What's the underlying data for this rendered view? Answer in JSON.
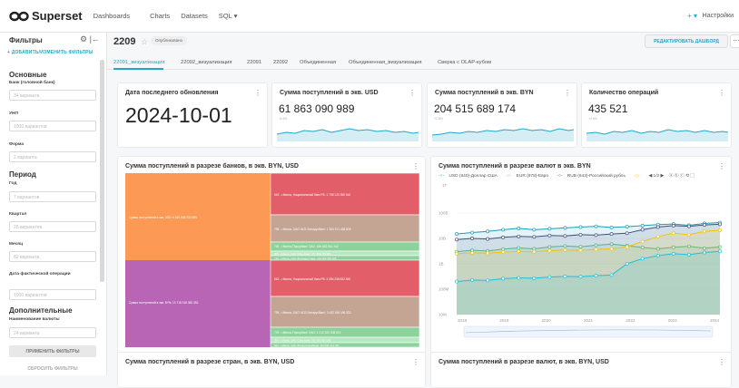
{
  "nav": {
    "logo": "Superset",
    "items": [
      "Dashboards",
      "Charts",
      "Datasets",
      "SQL ▾"
    ],
    "plus": "+ ▾",
    "settings": "Настройки"
  },
  "sidebar": {
    "title": "Фильтры",
    "add_link": "+ ДОБАВИТЬ/ИЗМЕНИТЬ ФИЛЬТРЫ",
    "sections": {
      "basic": "Основные",
      "period": "Период",
      "extra": "Дополнительные"
    },
    "filters": [
      {
        "label": "Банк (головной банк)",
        "placeholder": "34 варианта"
      },
      {
        "label": "УНП",
        "placeholder": "1000 вариантов"
      },
      {
        "label": "Форма",
        "placeholder": "2 варианта"
      },
      {
        "label": "Год",
        "placeholder": "7 вариантов"
      },
      {
        "label": "Квартал",
        "placeholder": "28 вариантов"
      },
      {
        "label": "Месяц",
        "placeholder": "82 варианта"
      },
      {
        "label": "Дата фактической операции",
        "placeholder": "1000 вариантов"
      },
      {
        "label": "Наименование валюты",
        "placeholder": "24 варианта"
      }
    ],
    "apply": "ПРИМЕНИТЬ ФИЛЬТРЫ",
    "clear": "СБРОСИТЬ ФИЛЬТРЫ"
  },
  "header": {
    "title": "2209",
    "badge": "Опубликовано",
    "edit": "РЕДАКТИРОВАТЬ ДАШБОРД",
    "more": "⋯"
  },
  "tabs": [
    "22091_визуализация",
    "22092_визуализация",
    "22091",
    "22092",
    "Объединенная",
    "Объединенная_визуализация",
    "Сверка с OLAP-кубом"
  ],
  "cards": {
    "last_update": {
      "title": "Дата последнего обновления",
      "value": "2024-10-01"
    },
    "kpis": [
      {
        "title": "Сумма поступлений в экв. USD",
        "value": "61 863 090 989",
        "delta": "-5.4%"
      },
      {
        "title": "Сумма поступлений в экв. BYN",
        "value": "204 515 689 174",
        "delta": "+2.8%"
      },
      {
        "title": "Количество операций",
        "value": "435 521",
        "delta": "+4.6%"
      }
    ],
    "treemap_title": "Сумма поступлений в разрезе банков, в экв. BYN, USD",
    "currency_title": "Сумма поступлений в разрезе валют в экв. BYN",
    "bottom_left_title": "Сумма поступлений в разрезе стран, в экв. BYN, USD",
    "bottom_right_title": "Сумма поступлений в разрезе валют, в экв. BYN, USD"
  },
  "treemap": {
    "usd_label": "Сумма поступлений в экв. USD: 6 549 838 332 889",
    "byn_label": "Сумма поступлений в экв. BYN: 13 718 318 382 352",
    "usd_banks": [
      "642 - г.Минск, Национальный банк РБ: 1 738 120 355 646",
      "795 - г.Минск, ОАО 'АСБ Беларусбанк': 1 354 071 408 838",
      "749 - г.Минск,'Приорбанк' ОАО: 406 832 951 442",
      "369 - г.Минск, ОАО 'Сбер Банк': 357 898 755 082",
      "739 - г.Минск, ОАО 'Белинвестбанк': 242 093 350 398"
    ],
    "byn_banks": [
      "642 - г.Минск, Национальный банк РБ: 4 054 238 832 846",
      "795 - г.Минск, ОАО 'АСБ Беларусбанк': 3 432 348 156 332",
      "749 - г.Минск,'Приорбанк' ОАО: 1 212 030 208 815",
      "369 - г.Минск, ОАО 'Сбер Банк': 893 903 952 083",
      "964 - г.Минск, ОАО 'Белагропромбанк': 900 997 312 021"
    ]
  },
  "chart_data": {
    "type": "line",
    "title": "Сумма поступлений в разрезе валют в экв. BYN",
    "legend_position": "top",
    "x_ticks": [
      "2018",
      "2019",
      "2020",
      "2021",
      "2022",
      "2023",
      "2024"
    ],
    "y_ticks": [
      "10M",
      "100M",
      "1B",
      "10B",
      "100B"
    ],
    "y_top_label": "1T",
    "y_scale": "log",
    "legend_pager": "◀ 1/2 ▶",
    "series": [
      {
        "name": "USD (840)-Доллар США",
        "color": "#1f9bbd",
        "values": [
          15000000000.0,
          17000000000.0,
          19000000000.0,
          22000000000.0,
          25000000000.0,
          22000000000.0,
          24000000000.0,
          26000000000.0,
          28000000000.0,
          30000000000.0,
          27000000000.0,
          29000000000.0,
          32000000000.0,
          35000000000.0,
          37000000000.0,
          33000000000.0,
          39000000000.0,
          42000000000.0
        ]
      },
      {
        "name": "EUR (978)-Евро",
        "color": "#5ac189",
        "values": [
          3000000000.0,
          3400000000.0,
          3200000000.0,
          3800000000.0,
          4200000000.0,
          3900000000.0,
          4600000000.0,
          5000000000.0,
          4700000000.0,
          5400000000.0,
          6000000000.0,
          5200000000.0,
          4400000000.0,
          3900000000.0,
          4500000000.0,
          4900000000.0,
          4100000000.0,
          4600000000.0
        ]
      },
      {
        "name": "RUB (643)-Российский рубль",
        "color": "#454e7c",
        "values": [
          9000000000.0,
          10000000000.0,
          9500000000.0,
          11000000000.0,
          12000000000.0,
          11500000000.0,
          13000000000.0,
          12500000000.0,
          14000000000.0,
          13500000000.0,
          15000000000.0,
          16000000000.0,
          22000000000.0,
          28000000000.0,
          32000000000.0,
          30000000000.0,
          34000000000.0,
          36000000000.0
        ]
      },
      {
        "name": "",
        "color": "#f5c400",
        "values": [
          2500000000.0,
          2700000000.0,
          2600000000.0,
          2900000000.0,
          3100000000.0,
          3000000000.0,
          3300000000.0,
          3500000000.0,
          3400000000.0,
          3700000000.0,
          3900000000.0,
          4600000000.0,
          7500000000.0,
          12000000000.0,
          16000000000.0,
          14000000000.0,
          19000000000.0,
          21000000000.0
        ]
      },
      {
        "name": "",
        "color": "#20c0d8",
        "values": [
          200000000.0,
          230000000.0,
          220000000.0,
          260000000.0,
          280000000.0,
          270000000.0,
          300000000.0,
          320000000.0,
          310000000.0,
          340000000.0,
          360000000.0,
          1000000000.0,
          1600000000.0,
          2100000000.0,
          2500000000.0,
          2300000000.0,
          2800000000.0,
          3100000000.0
        ]
      }
    ]
  }
}
